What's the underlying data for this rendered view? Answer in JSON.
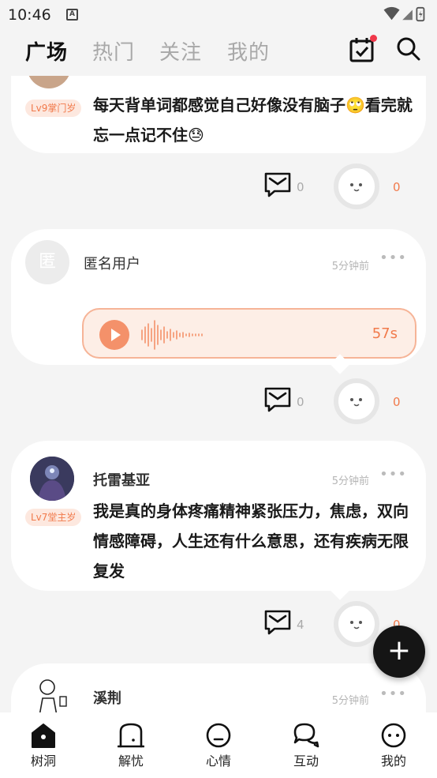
{
  "status_bar": {
    "time": "10:46",
    "notif_glyph": "A"
  },
  "top_tabs": [
    {
      "label": "广场",
      "active": true
    },
    {
      "label": "热门",
      "active": false
    },
    {
      "label": "关注",
      "active": false
    },
    {
      "label": "我的",
      "active": false
    }
  ],
  "posts": [
    {
      "level": "Lv9掌门岁",
      "text": "每天背单词都感觉自己好像没有脑子🙄看完就忘一点记不住😓",
      "comments": "0",
      "hugs": "0"
    },
    {
      "avatar_char": "匿",
      "username": "匿名用户",
      "time": "5分钟前",
      "more": "•••",
      "voice_duration": "57s",
      "comments": "0",
      "hugs": "0"
    },
    {
      "username": "托雷基亚",
      "level": "Lv7堂主岁",
      "time": "5分钟前",
      "more": "•••",
      "text": "我是真的身体疼痛精神紧张压力，焦虑，双向情感障碍，人生还有什么意思，还有疾病无限复发",
      "comments": "4",
      "hugs": "0"
    },
    {
      "username": "溪荆",
      "time": "5分钟前",
      "more": "•••"
    }
  ],
  "fab": {
    "label": "+"
  },
  "bottom_nav": [
    {
      "label": "树洞",
      "icon": "tree-hole-icon"
    },
    {
      "label": "解忧",
      "icon": "door-icon"
    },
    {
      "label": "心情",
      "icon": "mood-face-icon"
    },
    {
      "label": "互动",
      "icon": "chat-bubbles-icon"
    },
    {
      "label": "我的",
      "icon": "profile-face-icon"
    }
  ],
  "colors": {
    "accent": "#f17a4b",
    "badge_bg": "#fde8df",
    "voice_bg": "#fdeee6",
    "notification_dot": "#f0384a",
    "fab": "#151515"
  }
}
